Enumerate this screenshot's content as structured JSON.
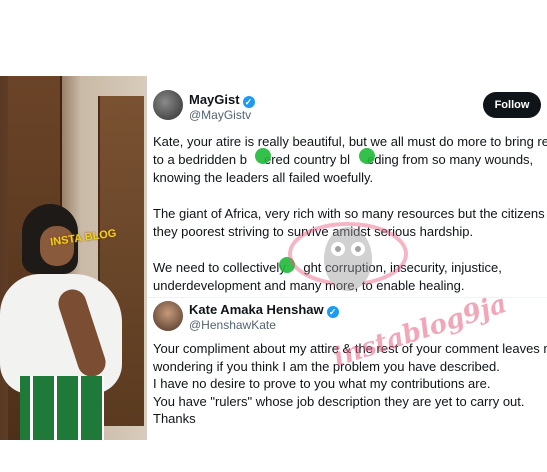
{
  "tweet": {
    "author_name": "MayGist",
    "author_handle": "@MayGistv",
    "follow_label": "Follow",
    "paragraphs": [
      [
        "Kate, your atire is really beautiful, but we all must do more to bring relie",
        "to a bedridden b",
        "ered country bl",
        "eding from so many wounds,",
        "knowing the leaders all failed woefully."
      ],
      [
        "The giant of Africa, very rich with so many resources but the citizens are",
        "they poorest striving to survive amidst serious hardship."
      ],
      [
        "We need to collectively ",
        "ght corruption, insecurity, injustice,",
        "underdevelopment and many more, to enable healing."
      ]
    ]
  },
  "reply": {
    "author_name": "Kate Amaka Henshaw",
    "author_handle": "@HenshawKate",
    "lines": [
      "Your compliment about my attire & the rest of your comment leaves me",
      "wondering if you think I am the problem you have described.",
      "I have no desire to prove to you what my contributions are.",
      "You have \"rulers\" whose job description they are yet to carry out.",
      "Thanks"
    ]
  },
  "photo_label": "INSTA BLOG",
  "watermark": "instablog9ja",
  "colors": {
    "verified": "#1d9bf0",
    "follow_bg": "#0f1419",
    "censor_blot": "#1fb83a",
    "watermark": "#e8607f"
  }
}
